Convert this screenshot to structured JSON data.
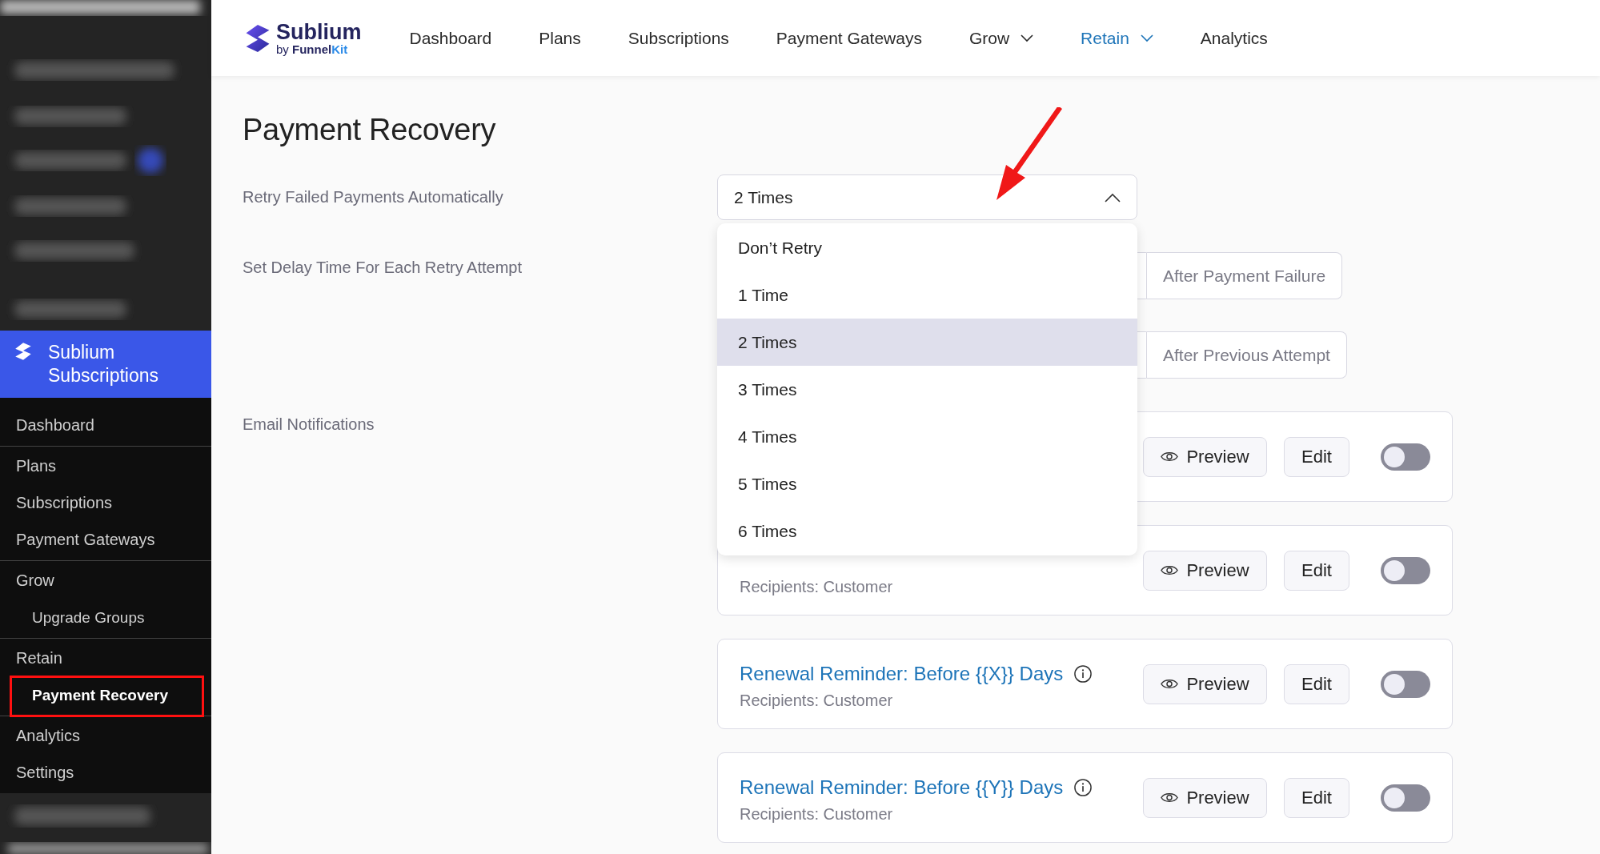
{
  "sidebar": {
    "brand": "Sublium Subscriptions",
    "groups": [
      {
        "items": [
          {
            "label": "Dashboard",
            "selected": false
          }
        ]
      },
      {
        "items": [
          {
            "label": "Plans",
            "selected": false
          },
          {
            "label": "Subscriptions",
            "selected": false
          },
          {
            "label": "Payment Gateways",
            "selected": false
          }
        ]
      },
      {
        "items": [
          {
            "label": "Grow",
            "selected": false,
            "children": [
              {
                "label": "Upgrade Groups",
                "selected": false
              }
            ]
          }
        ]
      },
      {
        "items": [
          {
            "label": "Retain",
            "selected": false,
            "children": [
              {
                "label": "Payment Recovery",
                "selected": true
              }
            ]
          }
        ]
      },
      {
        "items": [
          {
            "label": "Analytics",
            "selected": false
          },
          {
            "label": "Settings",
            "selected": false
          }
        ]
      }
    ]
  },
  "logo": {
    "name": "Sublium",
    "tagline_prefix": "by",
    "tagline_main": "Funnel",
    "tagline_accent": "Kit"
  },
  "nav": [
    {
      "label": "Dashboard",
      "selected": false,
      "has_menu": false
    },
    {
      "label": "Plans",
      "selected": false,
      "has_menu": false
    },
    {
      "label": "Subscriptions",
      "selected": false,
      "has_menu": false
    },
    {
      "label": "Payment Gateways",
      "selected": false,
      "has_menu": false
    },
    {
      "label": "Grow",
      "selected": false,
      "has_menu": true
    },
    {
      "label": "Retain",
      "selected": true,
      "has_menu": true
    },
    {
      "label": "Analytics",
      "selected": false,
      "has_menu": false
    }
  ],
  "page": {
    "title": "Payment Recovery",
    "retry": {
      "label": "Retry Failed Payments Automatically",
      "value": "2 Times",
      "expanded": true,
      "options": [
        {
          "label": "Don’t Retry",
          "selected": false
        },
        {
          "label": "1 Time",
          "selected": false
        },
        {
          "label": "2 Times",
          "selected": true
        },
        {
          "label": "3 Times",
          "selected": false
        },
        {
          "label": "4 Times",
          "selected": false
        },
        {
          "label": "5 Times",
          "selected": false
        },
        {
          "label": "6 Times",
          "selected": false
        }
      ]
    },
    "delay": {
      "label": "Set Delay Time For Each Retry Attempt",
      "fields": [
        {
          "suffix": "After Payment Failure"
        },
        {
          "suffix": "After Previous Attempt"
        }
      ]
    },
    "emails": {
      "label": "Email Notifications",
      "items": [
        {
          "preview": "Preview",
          "edit": "Edit",
          "on": false
        },
        {
          "recipients": "Recipients: Customer",
          "preview": "Preview",
          "edit": "Edit",
          "on": false
        },
        {
          "title": "Renewal Reminder: Before {{X}} Days",
          "recipients": "Recipients: Customer",
          "preview": "Preview",
          "edit": "Edit",
          "on": false
        },
        {
          "title": "Renewal Reminder: Before {{Y}} Days",
          "recipients": "Recipients: Customer",
          "preview": "Preview",
          "edit": "Edit",
          "on": false
        }
      ]
    }
  }
}
